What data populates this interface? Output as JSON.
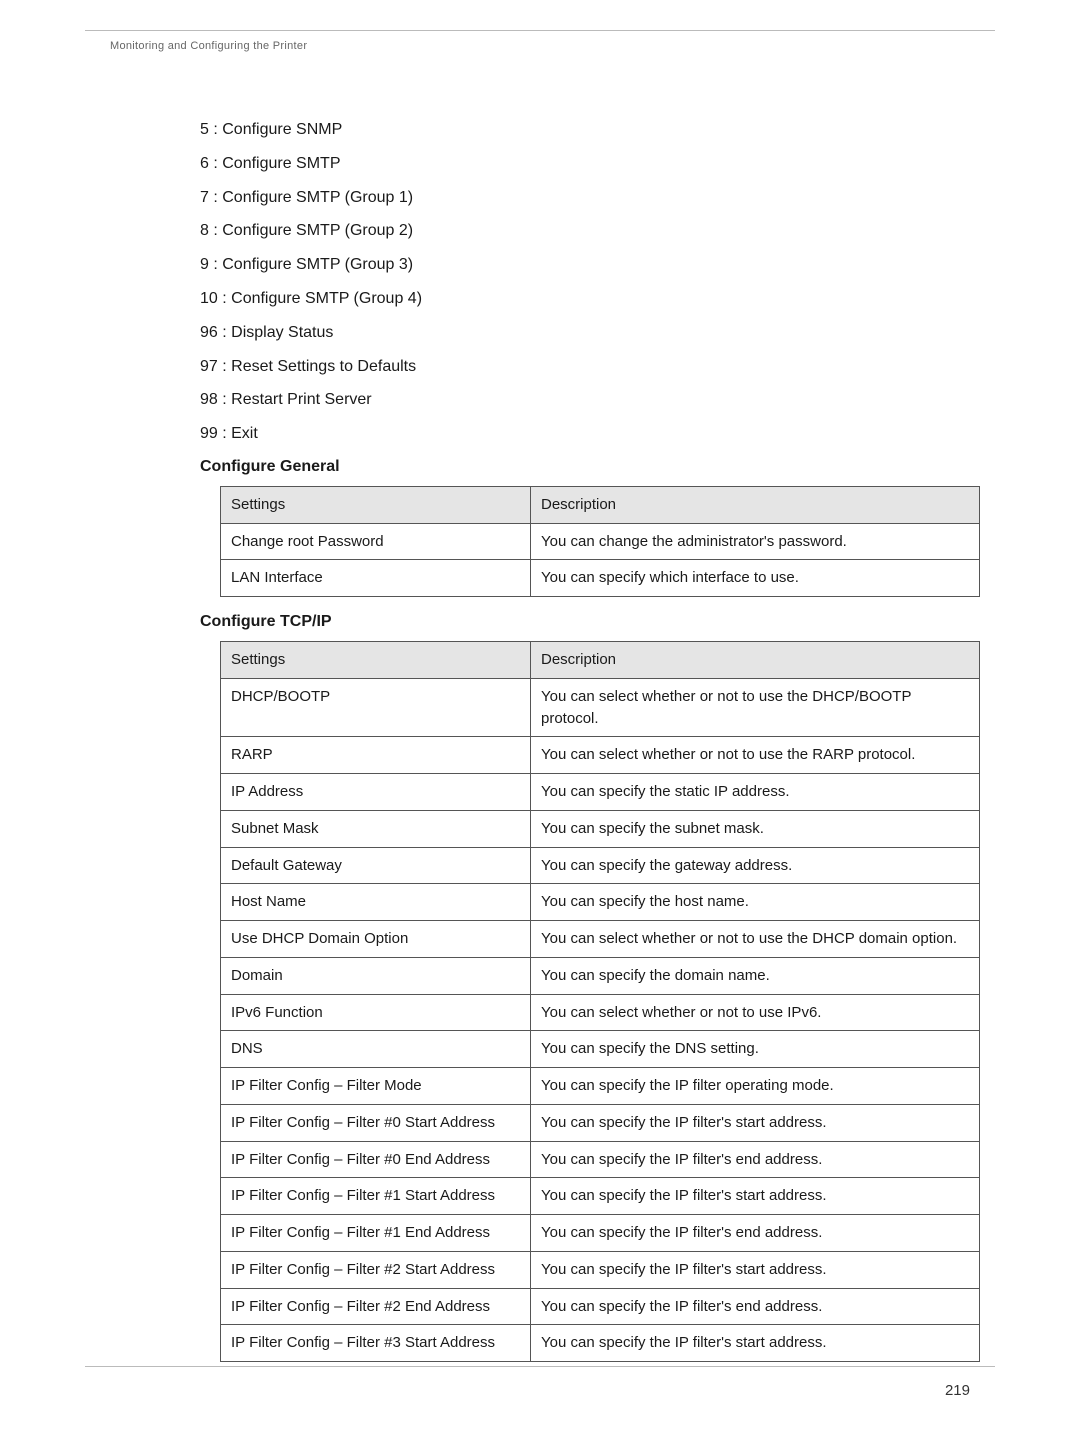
{
  "header": "Monitoring and Configuring the Printer",
  "menu_items": [
    "5 : Configure SNMP",
    "6 : Configure SMTP",
    "7 : Configure SMTP (Group 1)",
    "8 : Configure SMTP (Group 2)",
    "9 : Configure SMTP (Group 3)",
    "10 : Configure SMTP (Group 4)",
    "96 : Display Status",
    "97 : Reset Settings to Defaults",
    "98 : Restart Print Server",
    "99 : Exit"
  ],
  "section1": {
    "title": "Configure General",
    "col1": "Settings",
    "col2": "Description",
    "rows": [
      {
        "s": "Change root Password",
        "d": "You can change the administrator's password."
      },
      {
        "s": "LAN Interface",
        "d": "You can specify which interface to use."
      }
    ]
  },
  "section2": {
    "title": "Configure TCP/IP",
    "col1": "Settings",
    "col2": "Description",
    "rows": [
      {
        "s": "DHCP/BOOTP",
        "d": "You can select whether or not to use the DHCP/BOOTP protocol."
      },
      {
        "s": "RARP",
        "d": "You can select whether or not to use the RARP protocol."
      },
      {
        "s": "IP Address",
        "d": "You can specify the static IP address."
      },
      {
        "s": "Subnet Mask",
        "d": "You can specify the subnet mask."
      },
      {
        "s": "Default Gateway",
        "d": "You can specify the gateway address."
      },
      {
        "s": "Host Name",
        "d": "You can specify the host name."
      },
      {
        "s": "Use DHCP Domain Option",
        "d": "You can select whether or not to use the DHCP domain option."
      },
      {
        "s": "Domain",
        "d": "You can specify the domain name."
      },
      {
        "s": "IPv6 Function",
        "d": "You can select whether or not to use IPv6."
      },
      {
        "s": "DNS",
        "d": "You can specify the DNS setting."
      },
      {
        "s": "IP Filter Config – Filter Mode",
        "d": "You can specify the IP filter operating mode."
      },
      {
        "s": "IP Filter Config – Filter #0 Start Address",
        "d": "You can specify the IP filter's start address."
      },
      {
        "s": "IP Filter Config – Filter #0 End Address",
        "d": "You can specify the IP filter's end address."
      },
      {
        "s": "IP Filter Config – Filter #1 Start Address",
        "d": "You can specify the IP filter's start address."
      },
      {
        "s": "IP Filter Config – Filter #1 End Address",
        "d": "You can specify the IP filter's end address."
      },
      {
        "s": "IP Filter Config – Filter #2 Start Address",
        "d": "You can specify the IP filter's start address."
      },
      {
        "s": "IP Filter Config – Filter #2 End Address",
        "d": "You can specify the IP filter's end address."
      },
      {
        "s": "IP Filter Config – Filter #3 Start Address",
        "d": "You can specify the IP filter's start address."
      }
    ]
  },
  "page_number": "219"
}
